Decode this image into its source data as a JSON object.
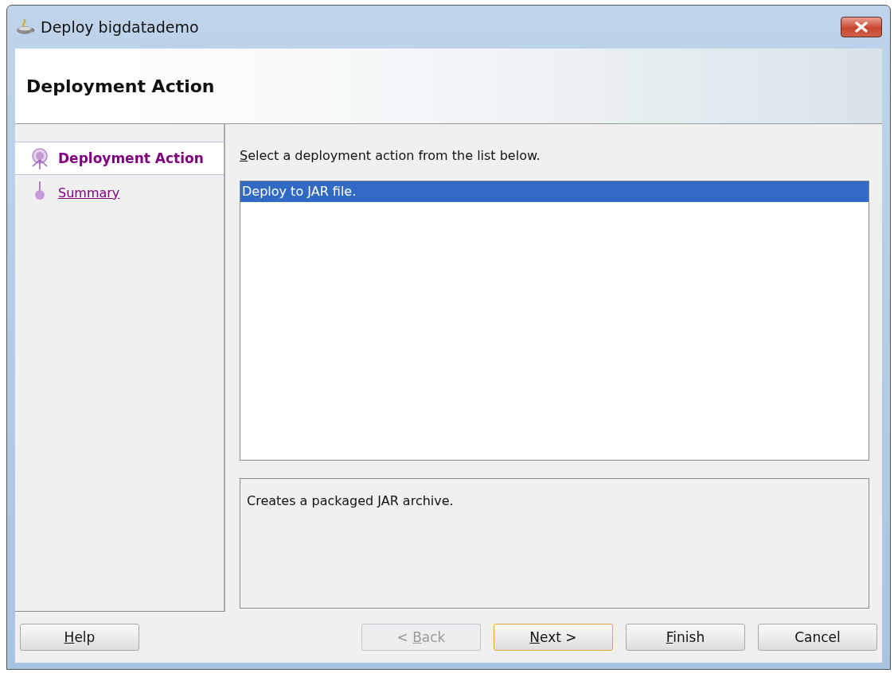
{
  "window": {
    "title": "Deploy bigdatademo"
  },
  "header": {
    "title": "Deployment Action"
  },
  "steps": [
    {
      "label": "Deployment Action",
      "selected": true
    },
    {
      "label": "Summary",
      "selected": false
    }
  ],
  "prompt": {
    "key": "S",
    "rest": "elect a deployment action from the list below."
  },
  "actions": [
    {
      "label": "Deploy to JAR file.",
      "selected": true
    }
  ],
  "description": "Creates a packaged JAR archive.",
  "help_button": {
    "key": "H",
    "rest": "elp",
    "disabled": false,
    "default": false
  },
  "buttons": [
    {
      "before": "< ",
      "key": "B",
      "rest": "ack",
      "disabled": true,
      "default": false
    },
    {
      "key": "N",
      "rest": "ext >",
      "disabled": false,
      "default": true
    },
    {
      "key": "F",
      "rest": "inish",
      "disabled": false,
      "default": false
    },
    {
      "rest": "Cancel",
      "disabled": false,
      "default": false
    }
  ]
}
